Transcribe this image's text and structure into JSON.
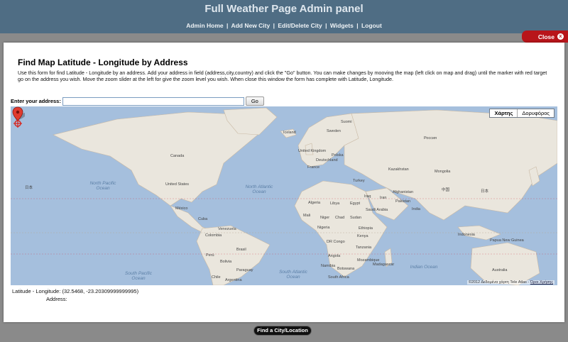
{
  "header": {
    "title": "Full Weather Page Admin panel",
    "nav": [
      "Admin Home",
      "Add New City",
      "Edit/Delete City",
      "Widgets",
      "Logout"
    ],
    "separator": "|"
  },
  "close": {
    "label": "Close",
    "icon": "x"
  },
  "modal": {
    "title": "Find Map Latitude - Longitude by Address",
    "description": "Use this form for find Latitude - Longitude by an address. Add your address in field (address,city,country) and click the \"Go\" button. You can make changes by mooving the map (left click on map and drag) until the marker with red target go on the address you wish. Move the zoom slider at the left for give the zoom level you wish. When close this window the form has complete with Latitude, Longitude.",
    "address_label": "Enter your address:",
    "address_value": "",
    "go_label": "Go"
  },
  "map": {
    "type_buttons": [
      "Χάρτης",
      "Δορυφόρος"
    ],
    "attribution": "©2012 Δεδομένα χάρτη Tele Atlas - ",
    "terms": "Όροι Χρήσης",
    "land_labels": [
      "Iceland",
      "Sweden",
      "Suomi",
      "United Kingdom",
      "Polska",
      "Deutschland",
      "France",
      "Россия",
      "Kazakhstan",
      "Mongolia",
      "Canada",
      "United States",
      "México",
      "Cuba",
      "Venezuela",
      "Colombia",
      "Brasil",
      "Perú",
      "Bolivia",
      "Chile",
      "Argentina",
      "Paraguay",
      "Algeria",
      "Libya",
      "Egypt",
      "Mali",
      "Niger",
      "Chad",
      "Sudan",
      "Nigeria",
      "Ethiopia",
      "DR Congo",
      "Kenya",
      "Tanzania",
      "Angola",
      "Namibia",
      "Botswana",
      "South Africa",
      "Madagascar",
      "Turkey",
      "Iraq",
      "Iran",
      "Saudi Arabia",
      "Afghanistan",
      "Pakistan",
      "India",
      "中国",
      "日本",
      "Papua New Guinea",
      "Australia",
      "Indonesia",
      "Mozambique"
    ],
    "ocean_labels": [
      "North Pacific Ocean",
      "North Atlantic Ocean",
      "South Pacific Ocean",
      "South Atlantic Ocean",
      "Indian Ocean",
      "日本"
    ]
  },
  "result": {
    "latlng_label": "Latitude - Longitude:",
    "latlng_value": "(32.5468, -23.20309999999995)",
    "address_label": "Address:",
    "address_value": ""
  },
  "footer": {
    "button": "Find a City/Location"
  },
  "colors": {
    "header_bg": "#4f6d84",
    "close_red": "#b8151a",
    "water": "#a5bfdd",
    "land": "#eae6dd"
  }
}
